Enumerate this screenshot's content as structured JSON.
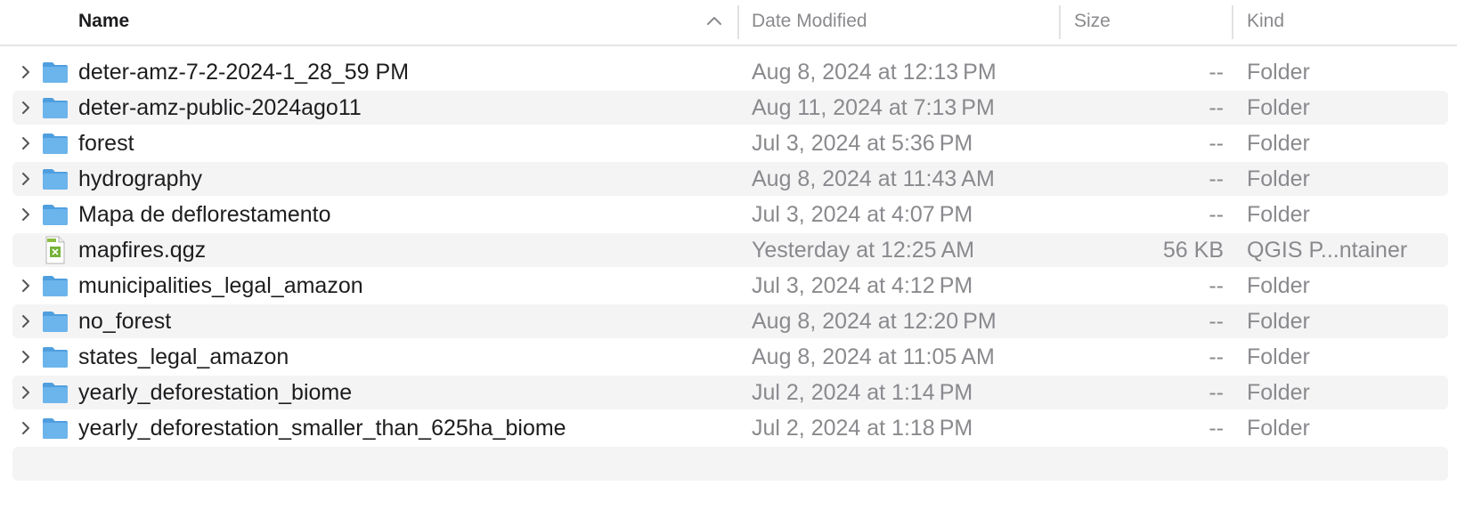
{
  "columns": {
    "name": "Name",
    "date": "Date Modified",
    "size": "Size",
    "kind": "Kind"
  },
  "files": [
    {
      "name": "deter-amz-7-2-2024-1_28_59 PM",
      "date": "Aug 8, 2024 at 12:13 PM",
      "size": "--",
      "kind": "Folder",
      "icon": "folder-icon",
      "expandable": true
    },
    {
      "name": "deter-amz-public-2024ago11",
      "date": "Aug 11, 2024 at 7:13 PM",
      "size": "--",
      "kind": "Folder",
      "icon": "folder-icon",
      "expandable": true
    },
    {
      "name": "forest",
      "date": "Jul 3, 2024 at 5:36 PM",
      "size": "--",
      "kind": "Folder",
      "icon": "folder-icon",
      "expandable": true
    },
    {
      "name": "hydrography",
      "date": "Aug 8, 2024 at 11:43 AM",
      "size": "--",
      "kind": "Folder",
      "icon": "folder-icon",
      "expandable": true
    },
    {
      "name": "Mapa de deflorestamento",
      "date": "Jul 3, 2024 at 4:07 PM",
      "size": "--",
      "kind": "Folder",
      "icon": "folder-icon",
      "expandable": true
    },
    {
      "name": "mapfires.qgz",
      "date": "Yesterday at 12:25 AM",
      "size": "56 KB",
      "kind": "QGIS P...ntainer",
      "icon": "qgz-file-icon",
      "expandable": false
    },
    {
      "name": "municipalities_legal_amazon",
      "date": "Jul 3, 2024 at 4:12 PM",
      "size": "--",
      "kind": "Folder",
      "icon": "folder-icon",
      "expandable": true
    },
    {
      "name": "no_forest",
      "date": "Aug 8, 2024 at 12:20 PM",
      "size": "--",
      "kind": "Folder",
      "icon": "folder-icon",
      "expandable": true
    },
    {
      "name": "states_legal_amazon",
      "date": "Aug 8, 2024 at 11:05 AM",
      "size": "--",
      "kind": "Folder",
      "icon": "folder-icon",
      "expandable": true
    },
    {
      "name": "yearly_deforestation_biome",
      "date": "Jul 2, 2024 at 1:14 PM",
      "size": "--",
      "kind": "Folder",
      "icon": "folder-icon",
      "expandable": true
    },
    {
      "name": "yearly_deforestation_smaller_than_625ha_biome",
      "date": "Jul 2, 2024 at 1:18 PM",
      "size": "--",
      "kind": "Folder",
      "icon": "folder-icon",
      "expandable": true
    }
  ],
  "colors": {
    "folder": "#6cb4ec",
    "folder_tab": "#4f9fdf",
    "row_alt": "#f4f4f5",
    "secondary_text": "#8a8a8e"
  }
}
